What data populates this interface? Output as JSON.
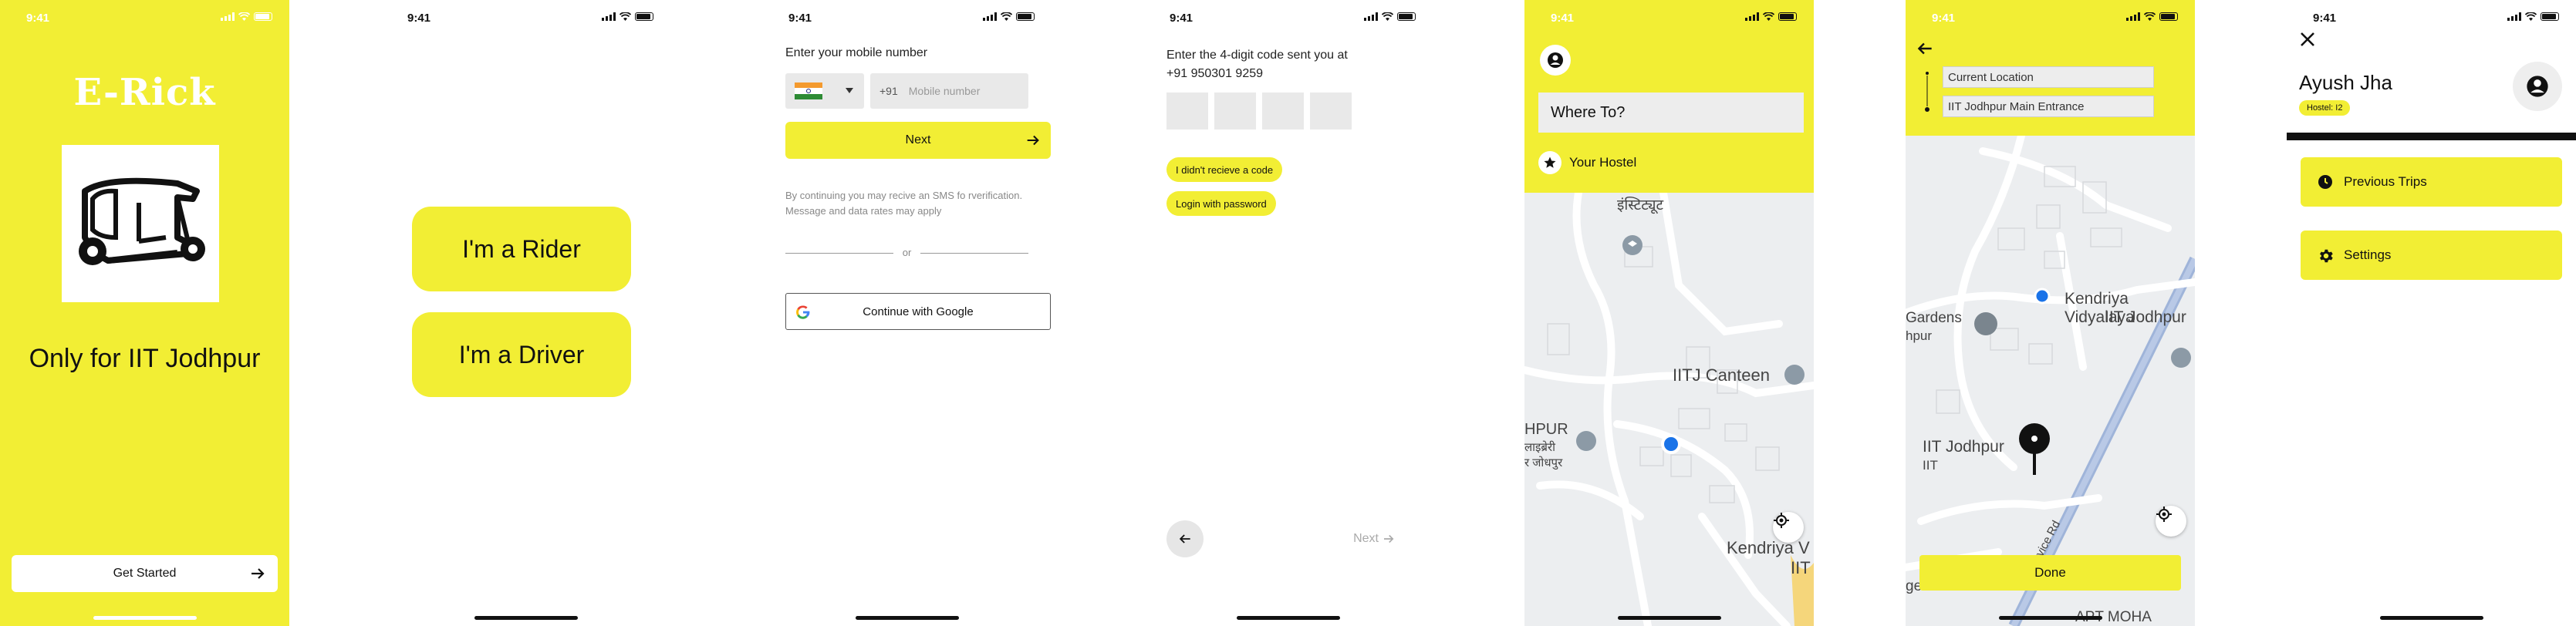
{
  "status": {
    "time": "9:41"
  },
  "splash": {
    "title": "E-Rick",
    "subtitle": "Only for IIT Jodhpur",
    "cta": "Get Started",
    "brand_color": "#f2ee34"
  },
  "role": {
    "rider": "I'm a Rider",
    "driver": "I'm a Driver"
  },
  "login": {
    "label": "Enter your mobile number",
    "country_code": "+91",
    "phone_placeholder": "Mobile number",
    "next": "Next",
    "note": "By continuing you may recive an SMS fo rverification. Message and data rates may apply",
    "or": "or",
    "google": "Continue with Google"
  },
  "otp": {
    "label": "Enter the 4-digit code sent you at",
    "phone": "+91 950301 9259",
    "no_code": "I didn't recieve a code",
    "password_login": "Login with password",
    "next": "Next"
  },
  "home": {
    "where_to": "Where To?",
    "saved_place": "Your Hostel",
    "map_labels": [
      "इंस्टिट्यूट",
      "IITJ Canteen",
      "HPUR",
      "लाइब्रेरी",
      "र जोधपुर",
      "Kendriya V",
      "IIT"
    ]
  },
  "route": {
    "from": "Current Location",
    "to": "IIT Jodhpur Main Entrance",
    "done": "Done",
    "map_labels": [
      "Kendriya Vidyalaya",
      "IIT Jodhpur",
      "Gardens",
      "hpur",
      "IIT Jodhpur",
      "IIT",
      "ervice Rd",
      "gence and Data...",
      "APT MOHA"
    ]
  },
  "profile": {
    "name": "Ayush Jha",
    "hostel_badge": "Hostel: I2",
    "menu": [
      "Previous Trips",
      "Settings"
    ]
  }
}
